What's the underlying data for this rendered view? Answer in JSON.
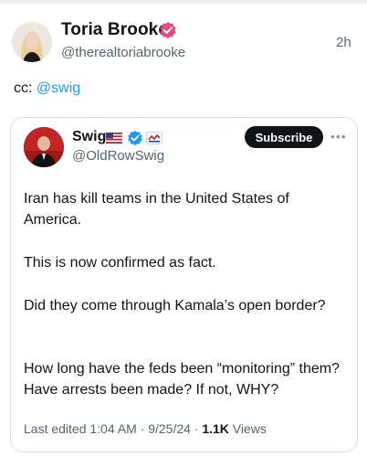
{
  "post": {
    "author_name": "Toria Brooke",
    "author_handle": "@therealtoriabrooke",
    "time_ago": "2h",
    "text_prefix": "cc: ",
    "mention": "@swig"
  },
  "quoted": {
    "author_name": "Swig",
    "author_handle": "@OldRowSwig",
    "subscribe_label": "Subscribe",
    "paragraphs": [
      "Iran has kill teams in the United States of America.",
      "This is now confirmed as fact.",
      "Did they come through Kamala’s open border?",
      "How long have the feds been “monitoring” them?  Have arrests been made? If not, WHY?"
    ],
    "meta_prefix": "Last edited 1:04 AM · 9/25/24 · ",
    "views_count": "1.1K",
    "views_label": " Views"
  },
  "icons": {
    "verified_badge_pink": "verified-badge-icon",
    "verified_badge_blue": "verified-badge-icon",
    "flag": "us-flag-icon",
    "affiliation": "affiliate-badge-icon",
    "more": "more-dots-icon"
  },
  "colors": {
    "accent_blue": "#1d9bf0",
    "pink_badge": "#e34c7d",
    "secondary_text": "#536471",
    "button_black": "#0f1419"
  }
}
